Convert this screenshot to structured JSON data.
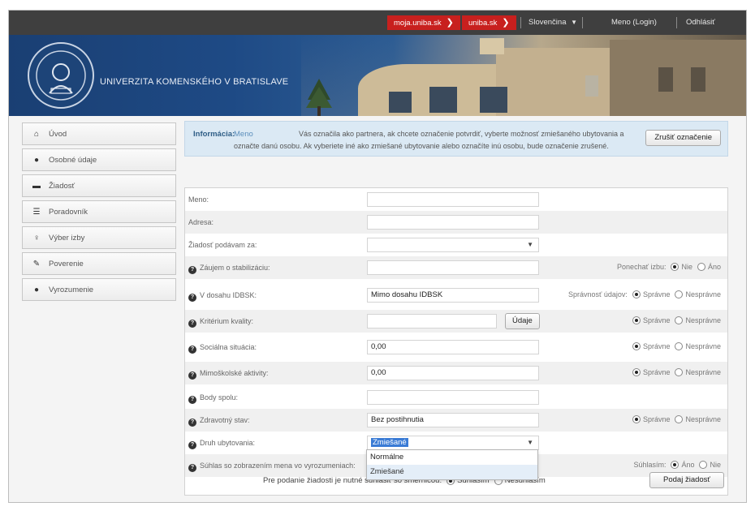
{
  "topbar": {
    "link1": "moja.uniba.sk",
    "link2": "uniba.sk",
    "language": "Slovenčina",
    "user": "Meno (Login)",
    "logout": "Odhlásiť",
    "accent_color": "#c8201e"
  },
  "header": {
    "university": "UNIVERZITA KOMENSKÉHO V BRATISLAVE"
  },
  "sidebar": {
    "items": [
      {
        "label": "Úvod",
        "icon": "home-icon"
      },
      {
        "label": "Osobné údaje",
        "icon": "user-icon"
      },
      {
        "label": "Žiadosť",
        "icon": "card-icon"
      },
      {
        "label": "Poradovník",
        "icon": "list-icon"
      },
      {
        "label": "Výber izby",
        "icon": "lightbulb-icon"
      },
      {
        "label": "Poverenie",
        "icon": "edit-icon"
      },
      {
        "label": "Vyrozumenie",
        "icon": "info-icon"
      }
    ]
  },
  "info": {
    "label": "Informácia:",
    "name": "Meno",
    "line1": "Vás označila ako partnera, ak chcete označenie potvrdiť, vyberte možnosť zmiešaného ubytovania a",
    "line2": "označte danú osobu. Ak vyberiete iné ako zmiešané ubytovanie alebo označíte inú osobu, bude označenie zrušené.",
    "cancel_button": "Zrušiť označenie"
  },
  "form": {
    "rows": [
      {
        "label": "Meno:",
        "value": ""
      },
      {
        "label": "Adresa:",
        "value": ""
      },
      {
        "label": "Žiadosť podávam za:",
        "value": ""
      },
      {
        "label": "Záujem o stabilizáciu:",
        "value": ""
      },
      {
        "label": "V dosahu IDBSK:",
        "value": "Mimo dosahu IDBSK"
      },
      {
        "label": "Kritérium kvality:",
        "value": ""
      },
      {
        "label": "Sociálna situácia:",
        "value": "0,00"
      },
      {
        "label": "Mimoškolské aktivity:",
        "value": "0,00"
      },
      {
        "label": "Body spolu:",
        "value": ""
      },
      {
        "label": "Zdravotný stav:",
        "value": "Bez postihnutia"
      },
      {
        "label": "Druh ubytovania:",
        "value": "Zmiešané"
      },
      {
        "label": "Súhlas so zobrazením mena vo vyrozumeniach:",
        "value": ""
      }
    ],
    "keep_room_label": "Ponechať izbu:",
    "correctness_label": "Správnosť údajov:",
    "correct": "Správne",
    "incorrect": "Nesprávne",
    "no": "Nie",
    "yes": "Áno",
    "details_button": "Údaje",
    "agree_label": "Súhlasím:",
    "dropdown_options": [
      "Normálne",
      "Zmiešané"
    ],
    "consent_text": "Pre podanie žiadosti je nutné súhlasiť so smernicou:",
    "agree": "Súhlasím",
    "disagree": "Nesúhlasím",
    "submit_button": "Podaj žiadosť"
  }
}
